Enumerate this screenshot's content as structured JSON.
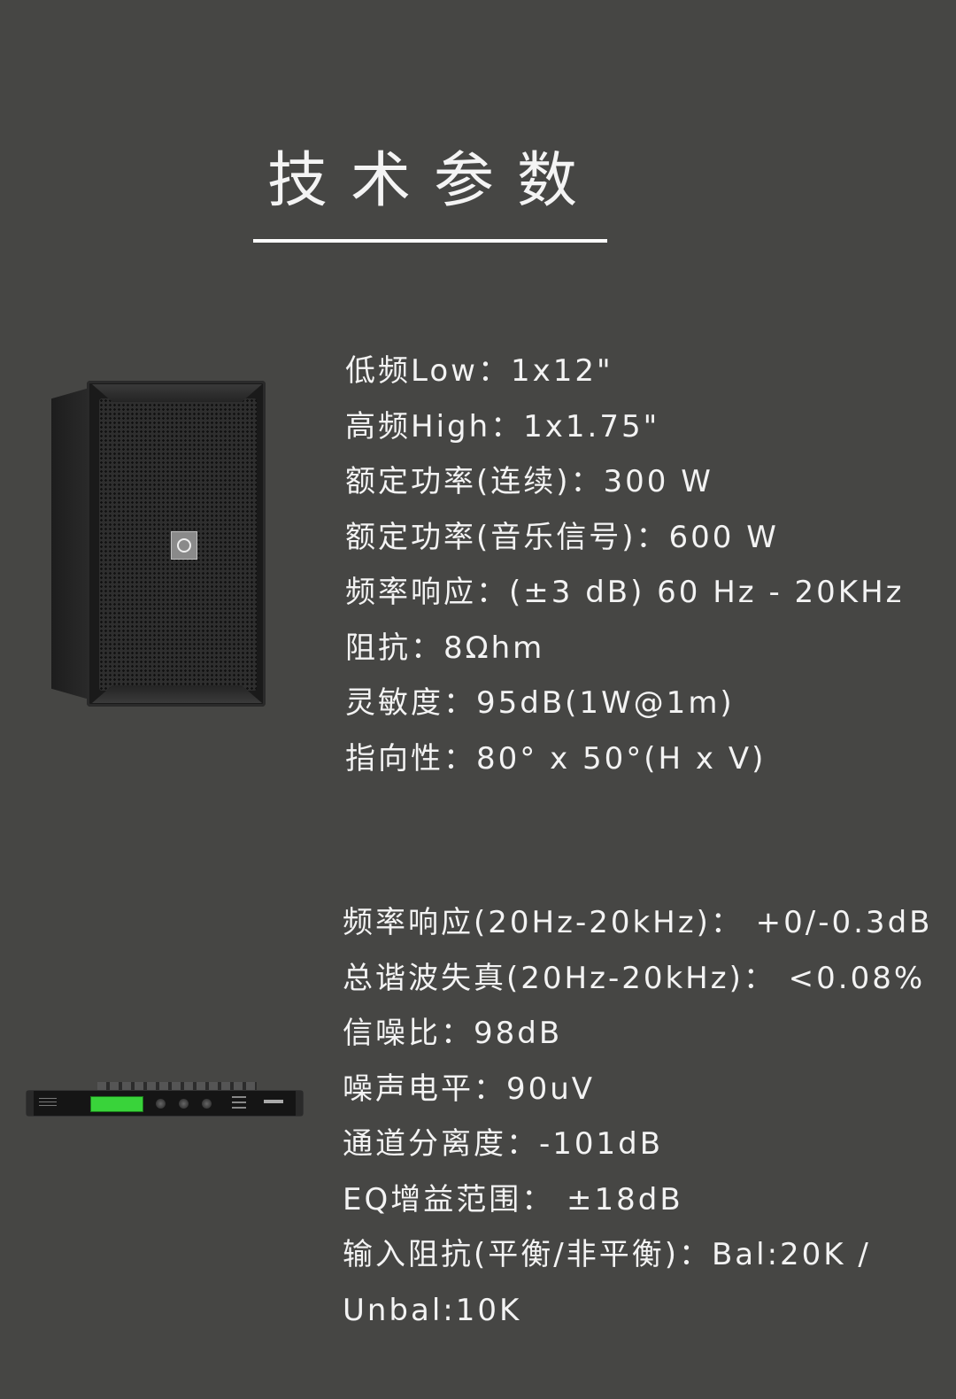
{
  "title": "技术参数",
  "speaker": {
    "specs": [
      "低频Low：1x12\"",
      "高频High：1x1.75\"",
      "额定功率(连续)：300 W",
      "额定功率(音乐信号)：600 W",
      "频率响应：(±3 dB) 60 Hz - 20KHz",
      "阻抗：8Ωhm",
      "灵敏度：95dB(1W@1m)",
      "指向性：80° x 50°(H x V)"
    ]
  },
  "processor": {
    "specs": [
      "频率响应(20Hz-20kHz)： +0/-0.3dB",
      "总谐波失真(20Hz-20kHz)： <0.08%",
      "信噪比：98dB",
      "噪声电平：90uV",
      "通道分离度：-101dB",
      "EQ增益范围： ±18dB",
      "输入阻抗(平衡/非平衡)：Bal:20K / Unbal:10K"
    ]
  },
  "colors": {
    "background": "#464644",
    "text": "#f3f3f3",
    "lcd": "#39d33a"
  }
}
